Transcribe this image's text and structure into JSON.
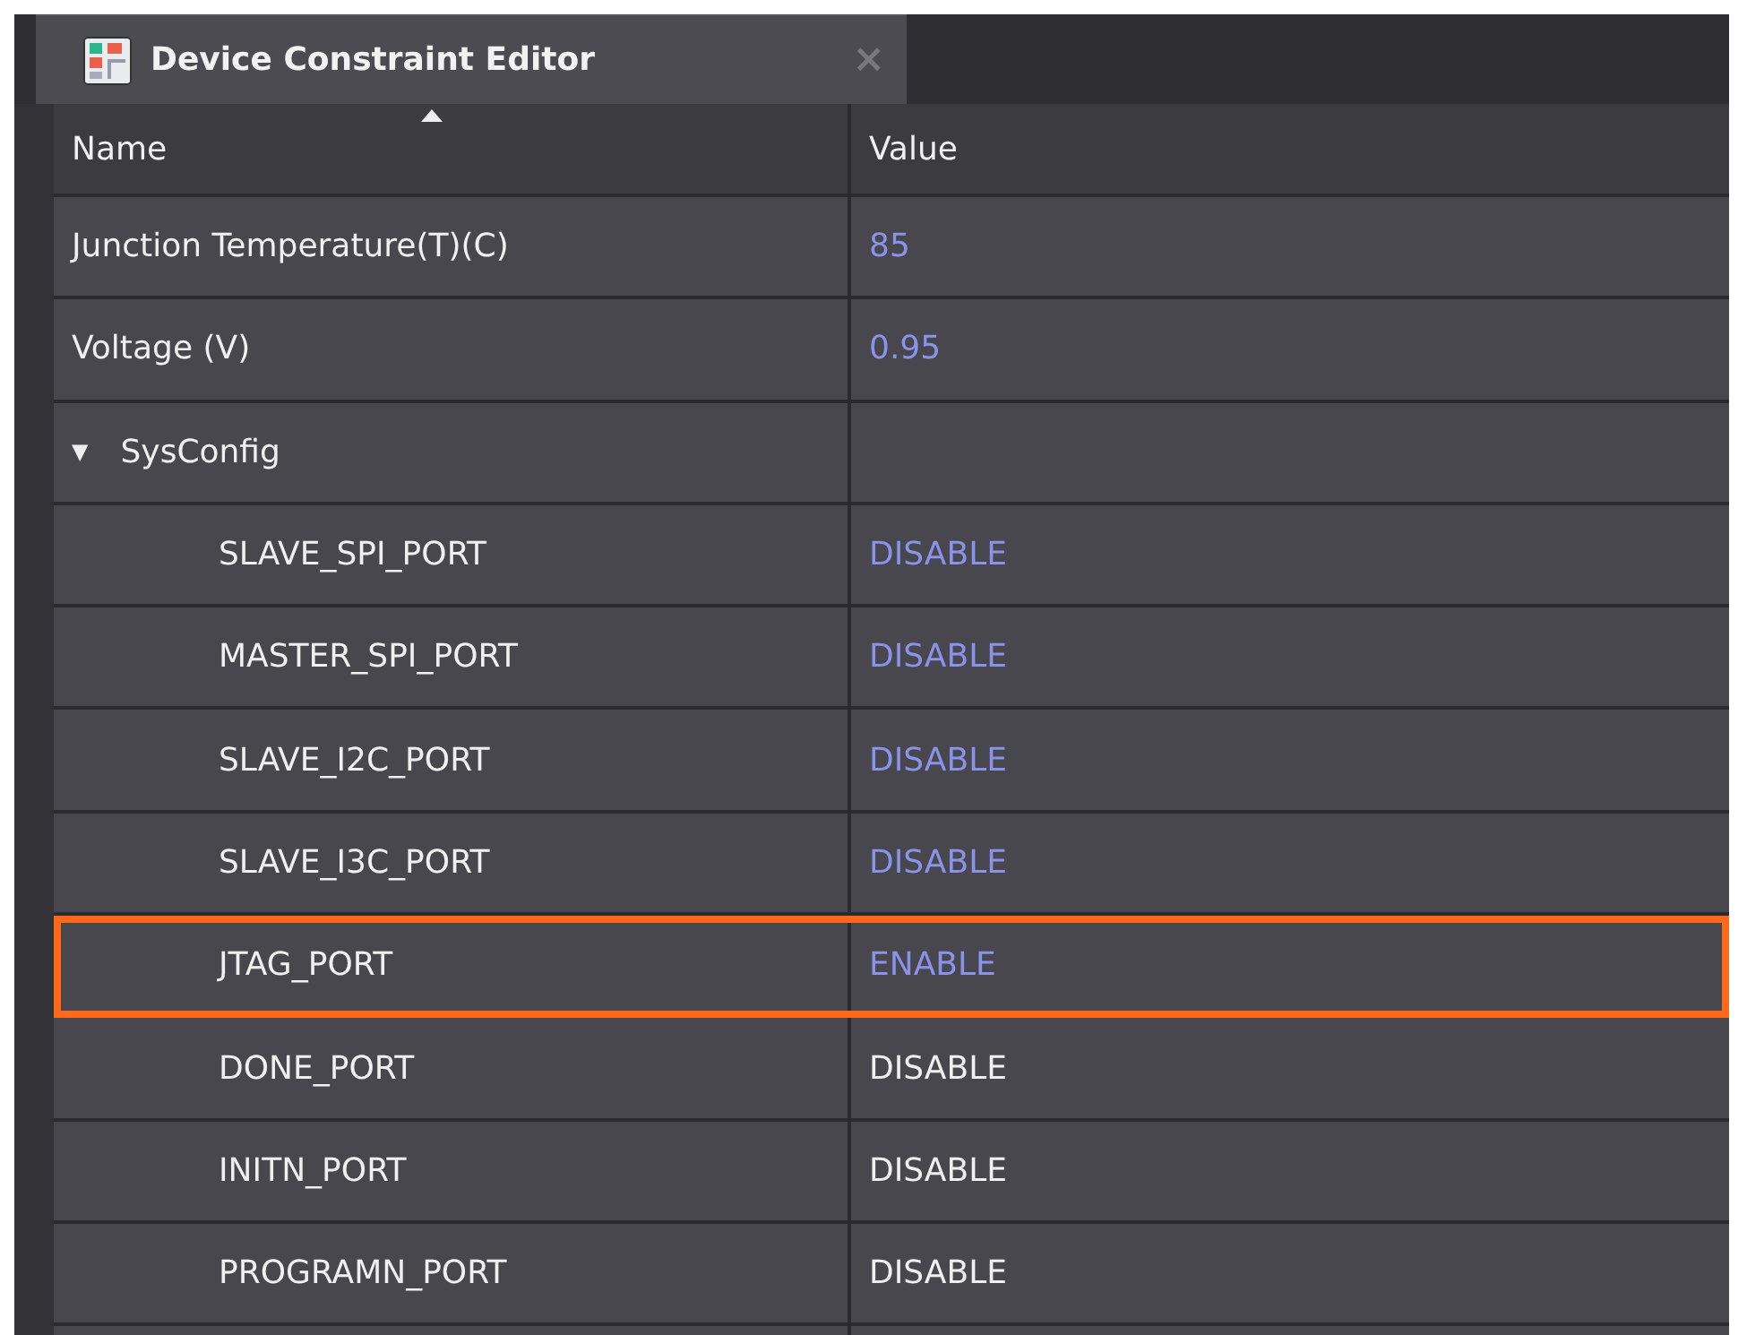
{
  "tab": {
    "title": "Device Constraint Editor",
    "close": "×"
  },
  "table": {
    "columns": [
      {
        "label": "Name",
        "sorted": true
      },
      {
        "label": "Value",
        "sorted": false
      }
    ],
    "rows": [
      {
        "name": "Junction Temperature(T)(C)",
        "value": "85",
        "modified": true,
        "highlighted": false
      },
      {
        "name": "Voltage (V)",
        "value": "0.95",
        "modified": true,
        "highlighted": false
      },
      {
        "name": "SysConfig",
        "expanded": true,
        "toggle": "▼",
        "children": [
          {
            "name": "SLAVE_SPI_PORT",
            "value": "DISABLE",
            "modified": true,
            "highlighted": false
          },
          {
            "name": "MASTER_SPI_PORT",
            "value": "DISABLE",
            "modified": true,
            "highlighted": false
          },
          {
            "name": "SLAVE_I2C_PORT",
            "value": "DISABLE",
            "modified": true,
            "highlighted": false
          },
          {
            "name": "SLAVE_I3C_PORT",
            "value": "DISABLE",
            "modified": true,
            "highlighted": false
          },
          {
            "name": "JTAG_PORT",
            "value": "ENABLE",
            "modified": true,
            "highlighted": true
          },
          {
            "name": "DONE_PORT",
            "value": "DISABLE",
            "modified": false,
            "highlighted": false
          },
          {
            "name": "INITN_PORT",
            "value": "DISABLE",
            "modified": false,
            "highlighted": false
          },
          {
            "name": "PROGRAMN_PORT",
            "value": "DISABLE",
            "modified": false,
            "highlighted": false
          }
        ]
      }
    ]
  }
}
